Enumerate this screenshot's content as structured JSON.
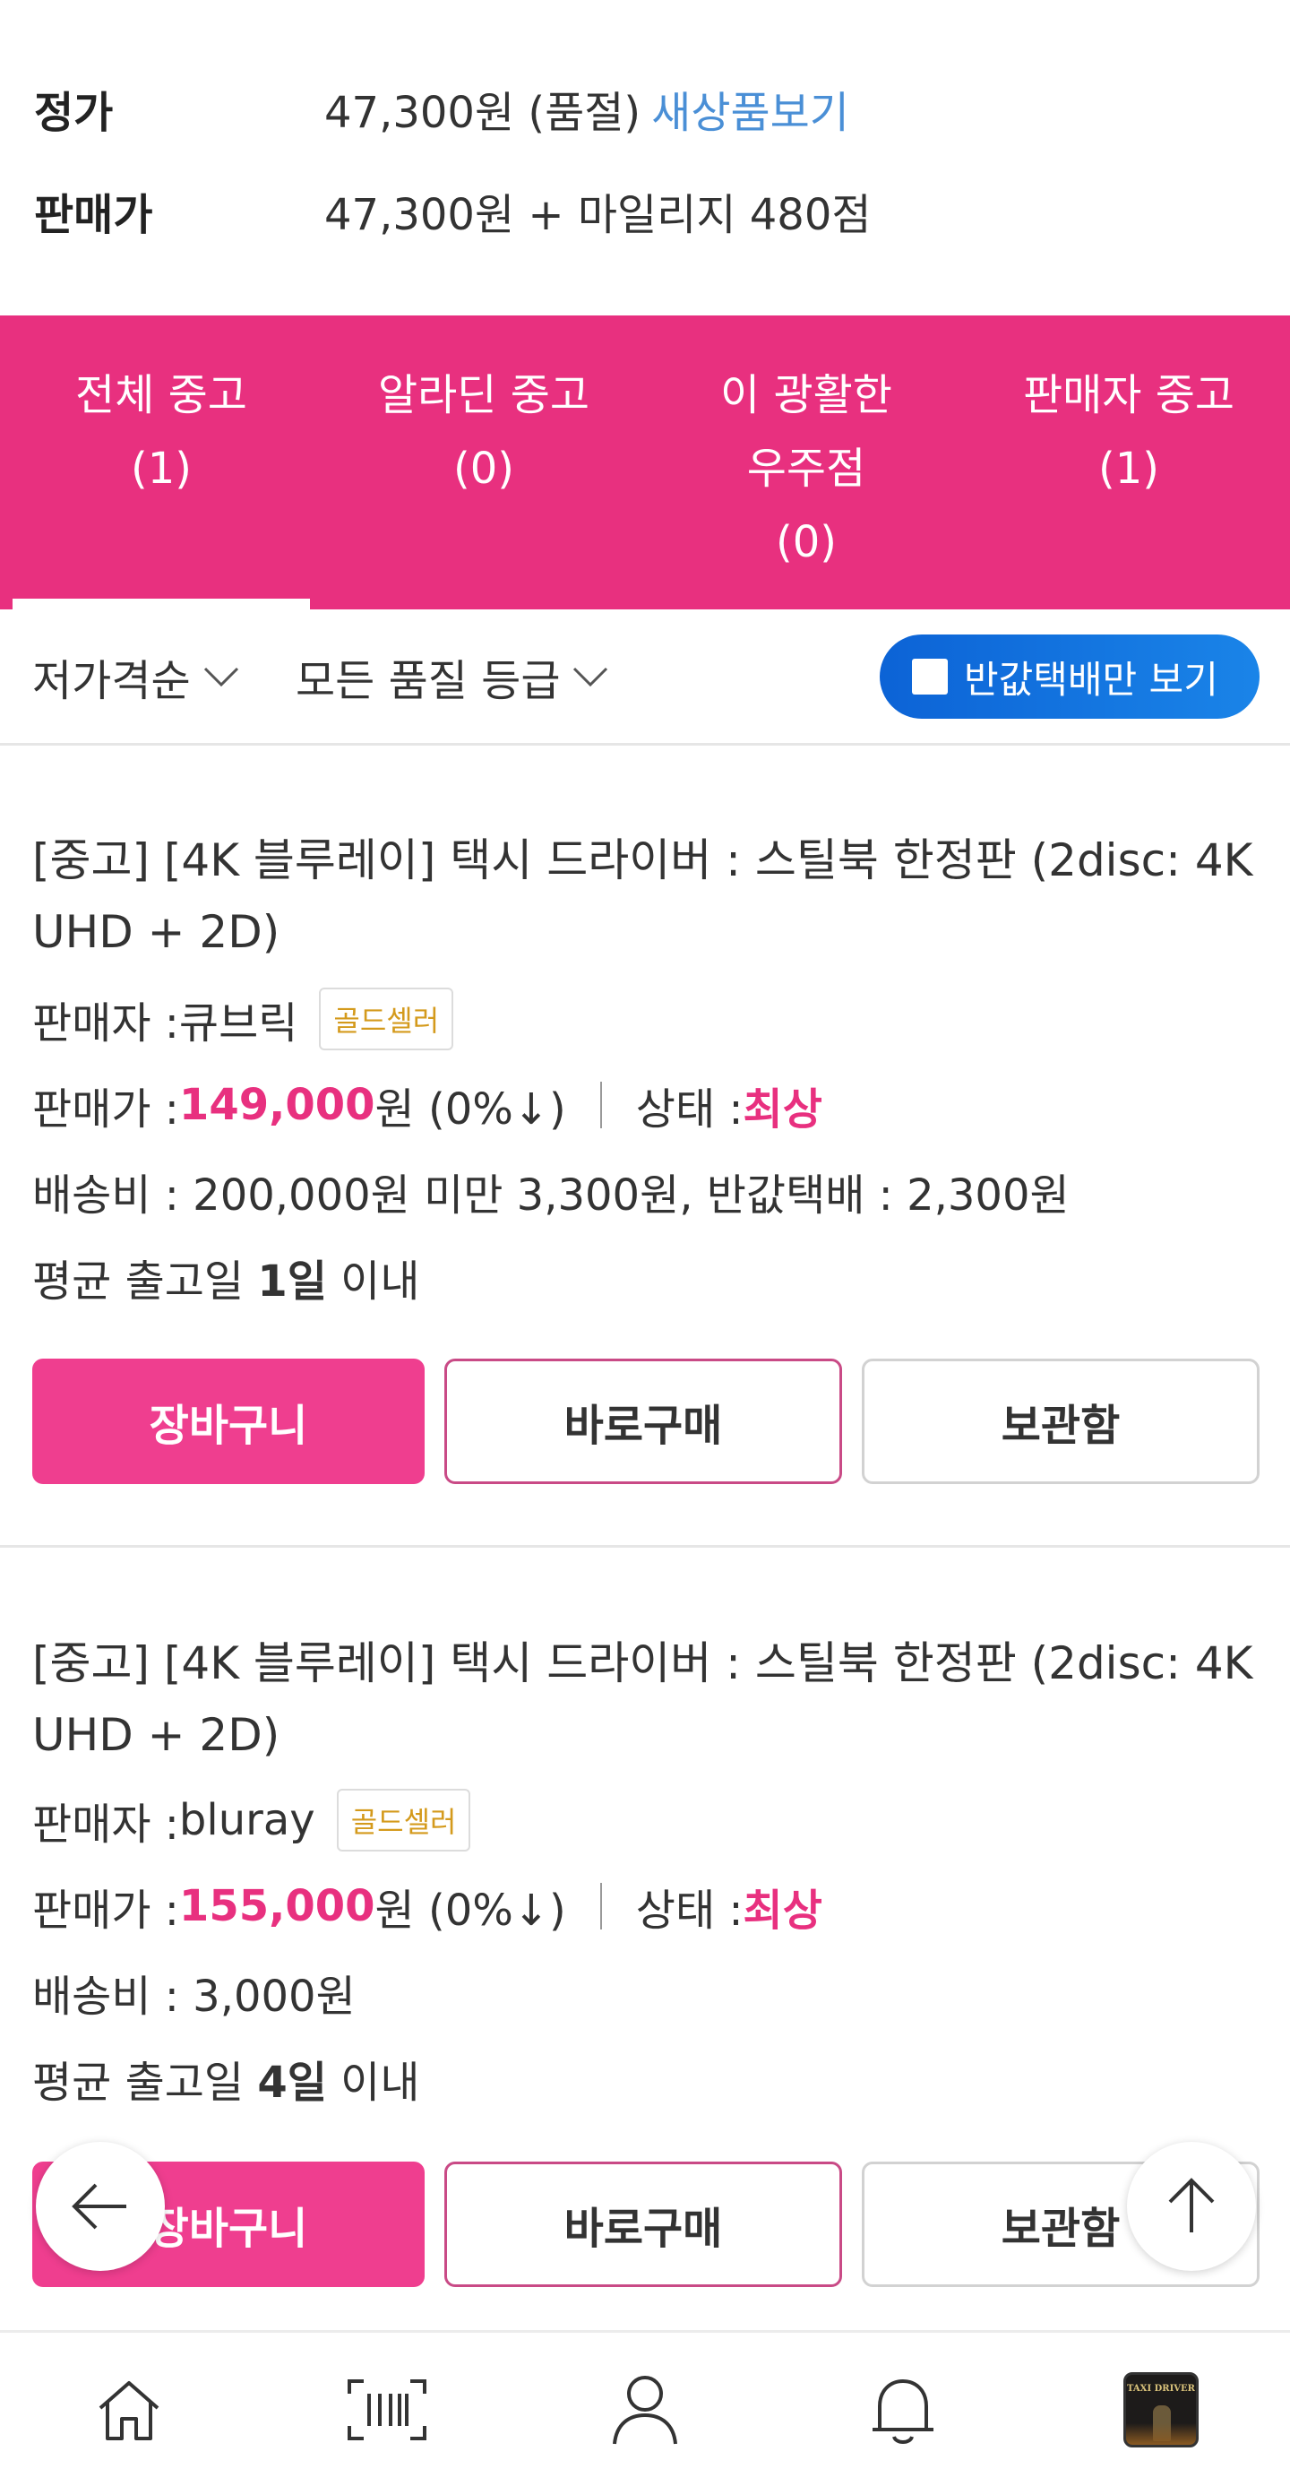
{
  "price": {
    "list_label": "정가",
    "list_value": "47,300원 (품절)",
    "new_link": "새상품보기",
    "sale_label": "판매가",
    "sale_value": "47,300원 + 마일리지 480점"
  },
  "tabs": [
    {
      "label": "전체 중고",
      "count": "(1)"
    },
    {
      "label": "알라딘 중고",
      "count": "(0)"
    },
    {
      "label": "이 광활한 우주점",
      "count": "(0)"
    },
    {
      "label": "판매자 중고",
      "count": "(1)"
    }
  ],
  "filters": {
    "sort": "저가격순",
    "quality": "모든 품질 등급",
    "half_delivery": "반값택배만 보기"
  },
  "items": [
    {
      "title": "[중고] [4K 블루레이] 택시 드라이버 : 스틸북 한정판 (2disc: 4K UHD + 2D)",
      "seller_label": "판매자 : ",
      "seller": "큐브릭",
      "badge": "골드셀러",
      "price_label": "판매가 : ",
      "price": "149,000",
      "price_suffix": "원 (0%↓)",
      "condition_label": "상태 : ",
      "condition": "최상",
      "shipping": "배송비 : 200,000원 미만 3,300원, 반값택배 : 2,300원",
      "ship_prefix": "평균 출고일 ",
      "ship_days": "1일",
      "ship_suffix": " 이내"
    },
    {
      "title": "[중고] [4K 블루레이] 택시 드라이버 : 스틸북 한정판 (2disc: 4K UHD + 2D)",
      "seller_label": "판매자 : ",
      "seller": "bluray",
      "badge": "골드셀러",
      "price_label": "판매가 : ",
      "price": "155,000",
      "price_suffix": "원 (0%↓)",
      "condition_label": "상태 : ",
      "condition": "최상",
      "shipping": "배송비 : 3,000원",
      "ship_prefix": "평균 출고일 ",
      "ship_days": "4일",
      "ship_suffix": " 이내"
    }
  ],
  "buttons": {
    "cart": "장바구니",
    "buy_now": "바로구매",
    "storage": "보관함"
  },
  "thumb_text": "TAXI DRIVER",
  "colors": {
    "accent": "#e8307f",
    "button_pink": "#ef3e8f",
    "link_blue": "#4a8fd6",
    "toggle_blue": "#0c63d6",
    "badge_gold": "#d49a1c"
  },
  "icons": [
    "home-icon",
    "barcode-icon",
    "user-icon",
    "bell-icon",
    "back-arrow-icon",
    "scroll-top-icon",
    "chevron-down-icon"
  ]
}
